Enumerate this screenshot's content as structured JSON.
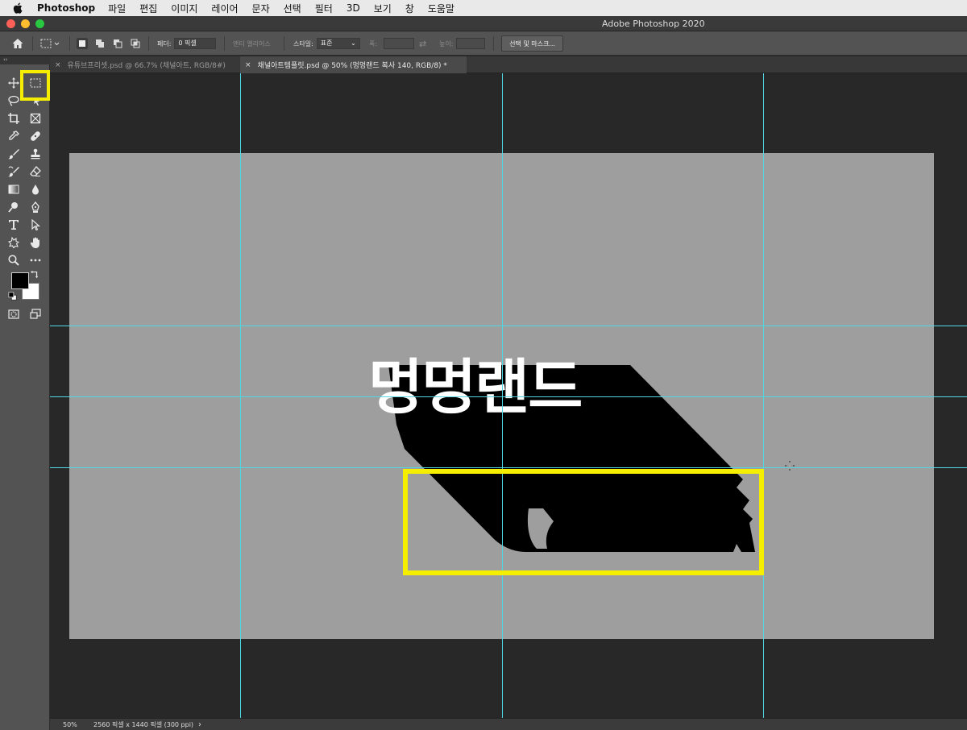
{
  "menubar": {
    "app_name": "Photoshop",
    "items": [
      "파일",
      "편집",
      "이미지",
      "레이어",
      "문자",
      "선택",
      "필터",
      "3D",
      "보기",
      "창",
      "도움말"
    ]
  },
  "window": {
    "title": "Adobe Photoshop 2020"
  },
  "options": {
    "feather_label": "페더:",
    "feather_value": "0 픽셀",
    "antialias_label": "앤티 앨리어스",
    "style_label": "스타일:",
    "style_value": "표준",
    "width_label": "폭:",
    "height_label": "높이:",
    "select_mask_button": "선택 및 마스크..."
  },
  "tabs": [
    {
      "label": "유튜브프리셋.psd @ 66.7% (채널아트, RGB/8#)",
      "active": false
    },
    {
      "label": "채널아트템플릿.psd @ 50% (멍멍랜드 복사 140, RGB/8) *",
      "active": true
    }
  ],
  "toolbar_collapse": "‹‹",
  "tools": [
    {
      "name": "move-tool-icon"
    },
    {
      "name": "rectangular-marquee-tool-icon"
    },
    {
      "name": "lasso-tool-icon"
    },
    {
      "name": "object-selection-tool-icon"
    },
    {
      "name": "crop-tool-icon"
    },
    {
      "name": "frame-tool-icon"
    },
    {
      "name": "eyedropper-tool-icon"
    },
    {
      "name": "healing-brush-tool-icon"
    },
    {
      "name": "brush-tool-icon"
    },
    {
      "name": "clone-stamp-tool-icon"
    },
    {
      "name": "history-brush-tool-icon"
    },
    {
      "name": "eraser-tool-icon"
    },
    {
      "name": "gradient-tool-icon"
    },
    {
      "name": "blur-tool-icon"
    },
    {
      "name": "dodge-tool-icon"
    },
    {
      "name": "pen-tool-icon"
    },
    {
      "name": "type-tool-icon"
    },
    {
      "name": "path-selection-tool-icon"
    },
    {
      "name": "custom-shape-tool-icon"
    },
    {
      "name": "hand-tool-icon"
    },
    {
      "name": "zoom-tool-icon"
    },
    {
      "name": "more-tools-icon"
    }
  ],
  "canvas": {
    "text": "멍멍랜드",
    "background": "#9e9e9e",
    "text_color": "#ffffff",
    "shadow_color": "#000000"
  },
  "colors": {
    "foreground": "#000000",
    "background": "#ffffff",
    "guide": "#4fd8e4",
    "highlight": "#f5ee00"
  },
  "status": {
    "zoom": "50%",
    "doc_info": "2560 픽셀 x 1440 픽셀 (300 ppi)",
    "arrow": "›"
  }
}
